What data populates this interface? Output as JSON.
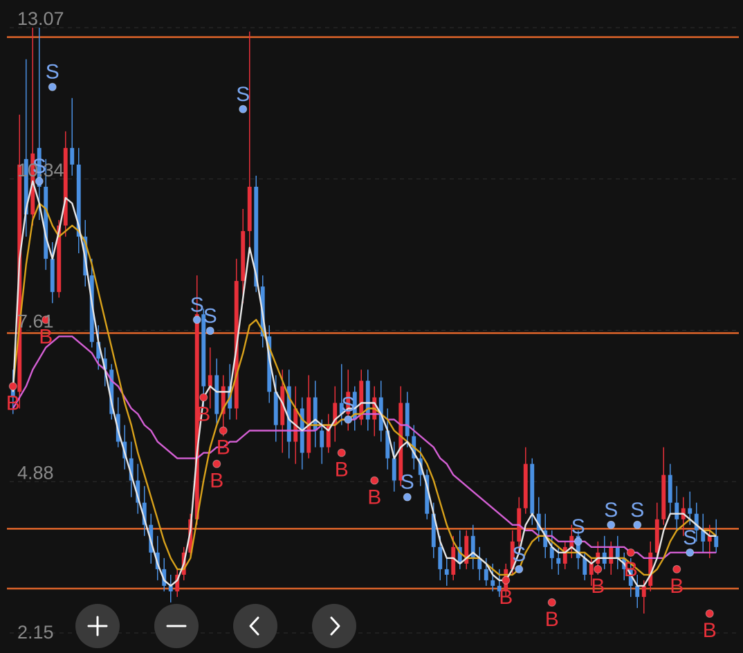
{
  "chart_data": {
    "type": "candlestick",
    "y_ticks": [
      "13.07",
      "10.34",
      "7.61",
      "4.88",
      "2.15"
    ],
    "ylim": [
      2.15,
      13.07
    ],
    "horizontal_levels": [
      12.9,
      7.56,
      4.03,
      2.95
    ],
    "candles": [
      [
        6.6,
        6.9,
        6.1,
        6.4
      ],
      [
        6.5,
        11.5,
        6.2,
        10.6
      ],
      [
        10.7,
        12.5,
        9.3,
        9.7
      ],
      [
        9.7,
        13.07,
        9.5,
        10.8
      ],
      [
        10.9,
        13.07,
        9.6,
        10.2
      ],
      [
        10.2,
        10.7,
        8.7,
        8.9
      ],
      [
        8.9,
        9.2,
        8.1,
        8.3
      ],
      [
        8.3,
        9.6,
        8.2,
        9.5
      ],
      [
        9.5,
        11.2,
        9.3,
        10.9
      ],
      [
        10.9,
        11.8,
        10.4,
        10.6
      ],
      [
        10.6,
        10.9,
        9.0,
        9.3
      ],
      [
        9.3,
        9.6,
        8.4,
        8.6
      ],
      [
        8.6,
        8.9,
        7.3,
        7.4
      ],
      [
        7.4,
        7.7,
        6.9,
        7.1
      ],
      [
        7.1,
        7.3,
        6.6,
        6.9
      ],
      [
        6.9,
        7.0,
        6.0,
        6.1
      ],
      [
        6.1,
        6.4,
        5.5,
        5.6
      ],
      [
        5.6,
        5.9,
        5.1,
        5.3
      ],
      [
        5.3,
        5.6,
        4.6,
        4.9
      ],
      [
        4.9,
        5.2,
        4.3,
        4.5
      ],
      [
        4.5,
        4.8,
        3.9,
        4.1
      ],
      [
        4.1,
        4.3,
        3.4,
        3.6
      ],
      [
        3.6,
        3.9,
        3.1,
        3.3
      ],
      [
        3.3,
        3.5,
        2.9,
        3.0
      ],
      [
        3.0,
        3.2,
        2.7,
        2.9
      ],
      [
        2.9,
        3.3,
        2.8,
        3.2
      ],
      [
        3.2,
        3.7,
        3.1,
        3.6
      ],
      [
        3.6,
        4.3,
        3.5,
        4.2
      ],
      [
        4.2,
        8.6,
        4.1,
        7.9
      ],
      [
        7.9,
        8.0,
        6.2,
        6.6
      ],
      [
        6.6,
        7.3,
        6.2,
        6.8
      ],
      [
        6.8,
        7.1,
        5.9,
        6.1
      ],
      [
        6.1,
        6.8,
        5.7,
        6.6
      ],
      [
        6.6,
        7.0,
        6.0,
        6.2
      ],
      [
        6.2,
        8.9,
        6.0,
        8.5
      ],
      [
        8.5,
        9.8,
        8.1,
        9.4
      ],
      [
        9.4,
        13.0,
        9.0,
        10.2
      ],
      [
        10.2,
        10.4,
        8.3,
        8.4
      ],
      [
        8.4,
        8.6,
        7.3,
        7.5
      ],
      [
        7.5,
        7.7,
        6.3,
        6.5
      ],
      [
        6.5,
        6.8,
        5.6,
        5.9
      ],
      [
        5.9,
        6.9,
        5.4,
        6.6
      ],
      [
        6.6,
        6.9,
        5.3,
        5.6
      ],
      [
        5.6,
        6.6,
        5.2,
        6.2
      ],
      [
        6.2,
        6.4,
        5.1,
        5.4
      ],
      [
        5.4,
        6.8,
        5.3,
        6.4
      ],
      [
        6.4,
        6.7,
        5.5,
        5.8
      ],
      [
        5.8,
        6.0,
        5.2,
        5.5
      ],
      [
        5.5,
        6.1,
        5.4,
        5.9
      ],
      [
        5.9,
        6.6,
        5.6,
        6.3
      ],
      [
        6.3,
        7.0,
        5.9,
        6.1
      ],
      [
        6.1,
        6.9,
        5.8,
        6.5
      ],
      [
        6.5,
        6.6,
        5.8,
        6.0
      ],
      [
        6.0,
        6.9,
        5.9,
        6.7
      ],
      [
        6.7,
        6.9,
        5.8,
        6.0
      ],
      [
        6.0,
        6.6,
        5.7,
        6.4
      ],
      [
        6.4,
        6.7,
        5.6,
        5.8
      ],
      [
        5.8,
        6.2,
        5.1,
        5.3
      ],
      [
        5.3,
        5.6,
        4.7,
        4.9
      ],
      [
        4.9,
        6.6,
        4.8,
        6.3
      ],
      [
        6.3,
        6.5,
        5.5,
        5.7
      ],
      [
        5.7,
        5.9,
        5.1,
        5.3
      ],
      [
        5.3,
        5.5,
        4.8,
        5.0
      ],
      [
        5.0,
        5.1,
        4.2,
        4.3
      ],
      [
        4.3,
        4.5,
        3.5,
        3.7
      ],
      [
        3.7,
        3.9,
        3.1,
        3.3
      ],
      [
        3.3,
        3.5,
        3.0,
        3.2
      ],
      [
        3.2,
        3.9,
        3.1,
        3.7
      ],
      [
        3.7,
        4.0,
        3.3,
        3.4
      ],
      [
        3.4,
        4.0,
        3.3,
        3.9
      ],
      [
        3.9,
        4.1,
        3.3,
        3.5
      ],
      [
        3.5,
        3.7,
        3.1,
        3.3
      ],
      [
        3.3,
        3.5,
        3.0,
        3.1
      ],
      [
        3.1,
        3.4,
        2.9,
        3.0
      ],
      [
        3.0,
        3.3,
        2.8,
        2.9
      ],
      [
        2.9,
        3.4,
        2.8,
        3.3
      ],
      [
        3.3,
        4.0,
        3.2,
        3.8
      ],
      [
        3.8,
        4.6,
        3.6,
        4.4
      ],
      [
        4.4,
        5.5,
        4.3,
        5.2
      ],
      [
        5.2,
        5.3,
        4.1,
        4.3
      ],
      [
        4.3,
        4.6,
        3.8,
        4.0
      ],
      [
        4.0,
        4.3,
        3.5,
        3.7
      ],
      [
        3.7,
        4.0,
        3.3,
        3.5
      ],
      [
        3.5,
        3.7,
        3.2,
        3.4
      ],
      [
        3.4,
        3.8,
        3.3,
        3.7
      ],
      [
        3.7,
        4.1,
        3.5,
        3.9
      ],
      [
        3.9,
        4.0,
        3.3,
        3.5
      ],
      [
        3.5,
        3.6,
        3.1,
        3.2
      ],
      [
        3.2,
        3.5,
        3.0,
        3.4
      ],
      [
        3.4,
        3.8,
        3.2,
        3.6
      ],
      [
        3.6,
        3.9,
        3.3,
        3.4
      ],
      [
        3.4,
        3.8,
        3.2,
        3.7
      ],
      [
        3.7,
        3.9,
        3.3,
        3.5
      ],
      [
        3.5,
        3.6,
        3.1,
        3.3
      ],
      [
        3.3,
        3.5,
        2.8,
        3.0
      ],
      [
        3.0,
        3.2,
        2.6,
        2.8
      ],
      [
        2.8,
        3.1,
        2.5,
        3.0
      ],
      [
        3.0,
        3.8,
        2.9,
        3.6
      ],
      [
        3.6,
        4.5,
        3.5,
        4.2
      ],
      [
        4.2,
        5.5,
        4.1,
        5.0
      ],
      [
        5.0,
        5.2,
        4.3,
        4.5
      ],
      [
        4.5,
        4.8,
        4.0,
        4.2
      ],
      [
        4.2,
        4.6,
        3.9,
        4.4
      ],
      [
        4.4,
        4.7,
        4.1,
        4.3
      ],
      [
        4.3,
        4.5,
        3.8,
        4.0
      ],
      [
        4.0,
        4.3,
        3.6,
        3.8
      ],
      [
        3.8,
        4.1,
        3.5,
        3.9
      ],
      [
        3.9,
        4.2,
        3.6,
        3.7
      ]
    ],
    "ma_short": [
      6.5,
      8.9,
      9.8,
      10.3,
      9.9,
      9.3,
      8.9,
      9.4,
      10.0,
      9.9,
      9.5,
      8.9,
      8.1,
      7.4,
      6.9,
      6.3,
      5.8,
      5.4,
      5.0,
      4.6,
      4.2,
      3.8,
      3.4,
      3.1,
      3.0,
      3.1,
      3.4,
      4.0,
      5.4,
      6.4,
      6.6,
      6.5,
      6.5,
      6.5,
      7.3,
      8.2,
      9.1,
      8.6,
      7.9,
      7.1,
      6.5,
      6.3,
      6.0,
      5.9,
      5.8,
      5.9,
      6.0,
      5.9,
      5.8,
      6.0,
      6.1,
      6.2,
      6.2,
      6.3,
      6.3,
      6.3,
      6.1,
      5.8,
      5.3,
      5.5,
      5.6,
      5.4,
      5.2,
      4.8,
      4.3,
      3.8,
      3.5,
      3.5,
      3.4,
      3.5,
      3.6,
      3.5,
      3.4,
      3.2,
      3.1,
      3.1,
      3.3,
      3.6,
      4.1,
      4.3,
      4.1,
      3.9,
      3.7,
      3.6,
      3.6,
      3.7,
      3.6,
      3.5,
      3.4,
      3.5,
      3.5,
      3.5,
      3.5,
      3.4,
      3.2,
      3.0,
      3.0,
      3.2,
      3.5,
      4.0,
      4.3,
      4.3,
      4.3,
      4.2,
      4.1,
      4.0,
      3.9,
      3.9
    ],
    "ma_mid": [
      6.6,
      7.7,
      8.8,
      9.6,
      9.9,
      9.8,
      9.5,
      9.3,
      9.4,
      9.5,
      9.4,
      9.2,
      8.8,
      8.3,
      7.8,
      7.3,
      6.8,
      6.3,
      5.9,
      5.4,
      5.0,
      4.6,
      4.2,
      3.8,
      3.5,
      3.3,
      3.3,
      3.5,
      4.2,
      4.9,
      5.5,
      5.9,
      6.2,
      6.4,
      6.8,
      7.2,
      7.7,
      7.8,
      7.6,
      7.3,
      7.0,
      6.7,
      6.4,
      6.2,
      6.0,
      5.9,
      5.9,
      5.9,
      5.9,
      5.9,
      6.0,
      6.0,
      6.1,
      6.1,
      6.2,
      6.2,
      6.1,
      6.0,
      5.8,
      5.7,
      5.6,
      5.5,
      5.4,
      5.2,
      4.9,
      4.5,
      4.1,
      3.8,
      3.6,
      3.5,
      3.5,
      3.5,
      3.4,
      3.3,
      3.2,
      3.2,
      3.2,
      3.3,
      3.6,
      3.8,
      3.9,
      3.9,
      3.8,
      3.7,
      3.6,
      3.6,
      3.6,
      3.6,
      3.5,
      3.5,
      3.5,
      3.5,
      3.5,
      3.5,
      3.4,
      3.3,
      3.2,
      3.2,
      3.3,
      3.5,
      3.8,
      4.0,
      4.1,
      4.2,
      4.1,
      4.0,
      4.0,
      3.9
    ],
    "ma_long": [
      6.2,
      6.4,
      6.6,
      6.9,
      7.1,
      7.3,
      7.4,
      7.5,
      7.5,
      7.5,
      7.4,
      7.3,
      7.2,
      7.0,
      6.9,
      6.7,
      6.6,
      6.4,
      6.2,
      6.1,
      5.9,
      5.8,
      5.6,
      5.5,
      5.4,
      5.3,
      5.3,
      5.3,
      5.3,
      5.4,
      5.4,
      5.5,
      5.5,
      5.6,
      5.6,
      5.7,
      5.8,
      5.8,
      5.8,
      5.8,
      5.8,
      5.8,
      5.8,
      5.8,
      5.8,
      5.8,
      5.8,
      5.9,
      5.9,
      5.9,
      6.0,
      6.0,
      6.0,
      6.1,
      6.1,
      6.1,
      6.1,
      6.0,
      6.0,
      5.9,
      5.9,
      5.8,
      5.7,
      5.6,
      5.5,
      5.3,
      5.2,
      5.0,
      4.9,
      4.8,
      4.7,
      4.6,
      4.5,
      4.4,
      4.3,
      4.2,
      4.1,
      4.1,
      4.0,
      4.0,
      3.9,
      3.9,
      3.9,
      3.8,
      3.8,
      3.8,
      3.8,
      3.8,
      3.7,
      3.7,
      3.7,
      3.7,
      3.7,
      3.7,
      3.6,
      3.6,
      3.5,
      3.5,
      3.5,
      3.5,
      3.6,
      3.6,
      3.6,
      3.6,
      3.6,
      3.6,
      3.6,
      3.6
    ],
    "signals": [
      {
        "i": 0,
        "type": "B",
        "price": 6.6
      },
      {
        "i": 4,
        "type": "S",
        "price": 10.3
      },
      {
        "i": 5,
        "type": "B",
        "price": 7.8
      },
      {
        "i": 6,
        "type": "S",
        "price": 12.0
      },
      {
        "i": 28,
        "type": "S",
        "price": 7.8
      },
      {
        "i": 29,
        "type": "B",
        "price": 6.4
      },
      {
        "i": 30,
        "type": "S",
        "price": 7.6
      },
      {
        "i": 31,
        "type": "B",
        "price": 5.2
      },
      {
        "i": 32,
        "type": "B",
        "price": 5.8
      },
      {
        "i": 35,
        "type": "S",
        "price": 11.6
      },
      {
        "i": 50,
        "type": "B",
        "price": 5.4
      },
      {
        "i": 51,
        "type": "S",
        "price": 6.0
      },
      {
        "i": 55,
        "type": "B",
        "price": 4.9
      },
      {
        "i": 60,
        "type": "S",
        "price": 4.6
      },
      {
        "i": 75,
        "type": "B",
        "price": 3.1
      },
      {
        "i": 77,
        "type": "S",
        "price": 3.3
      },
      {
        "i": 82,
        "type": "B",
        "price": 2.7
      },
      {
        "i": 86,
        "type": "S",
        "price": 3.8
      },
      {
        "i": 89,
        "type": "B",
        "price": 3.3
      },
      {
        "i": 91,
        "type": "S",
        "price": 4.1
      },
      {
        "i": 94,
        "type": "B",
        "price": 3.6
      },
      {
        "i": 95,
        "type": "S",
        "price": 4.1
      },
      {
        "i": 101,
        "type": "B",
        "price": 3.3
      },
      {
        "i": 103,
        "type": "S",
        "price": 3.6
      },
      {
        "i": 106,
        "type": "B",
        "price": 2.5
      }
    ]
  },
  "colors": {
    "background": "#121212",
    "up": "#e8303a",
    "down": "#4a90e2",
    "level_line": "#e0652a",
    "ma_short": "#e6e6e6",
    "ma_mid": "#d9a21b",
    "ma_long": "#d45fd4",
    "tick_text": "#8a8a8a",
    "signal_S": "#79a6f0",
    "signal_B": "#e8303a",
    "button_bg": "#3a3a3a"
  },
  "controls": [
    {
      "name": "zoom-in-button",
      "icon": "plus-icon"
    },
    {
      "name": "zoom-out-button",
      "icon": "minus-icon"
    },
    {
      "name": "scroll-left-button",
      "icon": "chevron-left-icon"
    },
    {
      "name": "scroll-right-button",
      "icon": "chevron-right-icon"
    }
  ]
}
